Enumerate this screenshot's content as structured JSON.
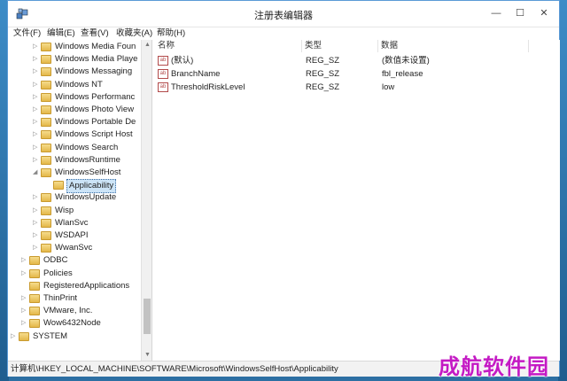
{
  "window": {
    "title": "注册表编辑器",
    "controls": {
      "minimize": "—",
      "maximize": "☐",
      "close": "✕"
    }
  },
  "menu": [
    "文件(F)",
    "编辑(E)",
    "查看(V)",
    "收藏夹(A)",
    "帮助(H)"
  ],
  "tree": {
    "rows": [
      {
        "label": "Windows Media Foun",
        "level": 3,
        "expander": "▷",
        "selected": false
      },
      {
        "label": "Windows Media Playe",
        "level": 3,
        "expander": "▷",
        "selected": false
      },
      {
        "label": "Windows Messaging",
        "level": 3,
        "expander": "▷",
        "selected": false
      },
      {
        "label": "Windows NT",
        "level": 3,
        "expander": "▷",
        "selected": false
      },
      {
        "label": "Windows Performanc",
        "level": 3,
        "expander": "▷",
        "selected": false
      },
      {
        "label": "Windows Photo View",
        "level": 3,
        "expander": "▷",
        "selected": false
      },
      {
        "label": "Windows Portable De",
        "level": 3,
        "expander": "▷",
        "selected": false
      },
      {
        "label": "Windows Script Host",
        "level": 3,
        "expander": "▷",
        "selected": false
      },
      {
        "label": "Windows Search",
        "level": 3,
        "expander": "▷",
        "selected": false
      },
      {
        "label": "WindowsRuntime",
        "level": 3,
        "expander": "▷",
        "selected": false
      },
      {
        "label": "WindowsSelfHost",
        "level": 3,
        "expander": "◢",
        "selected": false
      },
      {
        "label": "Applicability",
        "level": 4,
        "expander": "",
        "selected": true
      },
      {
        "label": "WindowsUpdate",
        "level": 3,
        "expander": "▷",
        "selected": false
      },
      {
        "label": "Wisp",
        "level": 3,
        "expander": "▷",
        "selected": false
      },
      {
        "label": "WlanSvc",
        "level": 3,
        "expander": "▷",
        "selected": false
      },
      {
        "label": "WSDAPI",
        "level": 3,
        "expander": "▷",
        "selected": false
      },
      {
        "label": "WwanSvc",
        "level": 3,
        "expander": "▷",
        "selected": false
      },
      {
        "label": "ODBC",
        "level": 2,
        "expander": "▷",
        "selected": false
      },
      {
        "label": "Policies",
        "level": 2,
        "expander": "▷",
        "selected": false
      },
      {
        "label": "RegisteredApplications",
        "level": 2,
        "expander": "",
        "selected": false
      },
      {
        "label": "ThinPrint",
        "level": 2,
        "expander": "▷",
        "selected": false
      },
      {
        "label": "VMware, Inc.",
        "level": 2,
        "expander": "▷",
        "selected": false
      },
      {
        "label": "Wow6432Node",
        "level": 2,
        "expander": "▷",
        "selected": false
      },
      {
        "label": "SYSTEM",
        "level": 1,
        "expander": "▷",
        "selected": false
      }
    ]
  },
  "list": {
    "columns": [
      "名称",
      "类型",
      "数据"
    ],
    "rows": [
      {
        "icon": "ab",
        "name": "(默认)",
        "type": "REG_SZ",
        "data": "(数值未设置)"
      },
      {
        "icon": "ab",
        "name": "BranchName",
        "type": "REG_SZ",
        "data": "fbl_release"
      },
      {
        "icon": "ab",
        "name": "ThresholdRiskLevel",
        "type": "REG_SZ",
        "data": "low"
      }
    ]
  },
  "status": "计算机\\HKEY_LOCAL_MACHINE\\SOFTWARE\\Microsoft\\WindowsSelfHost\\Applicability",
  "watermark": "成航软件园",
  "icons": {
    "app": "regedit-icon",
    "folder": "folder-icon",
    "value": "string-value-icon"
  }
}
